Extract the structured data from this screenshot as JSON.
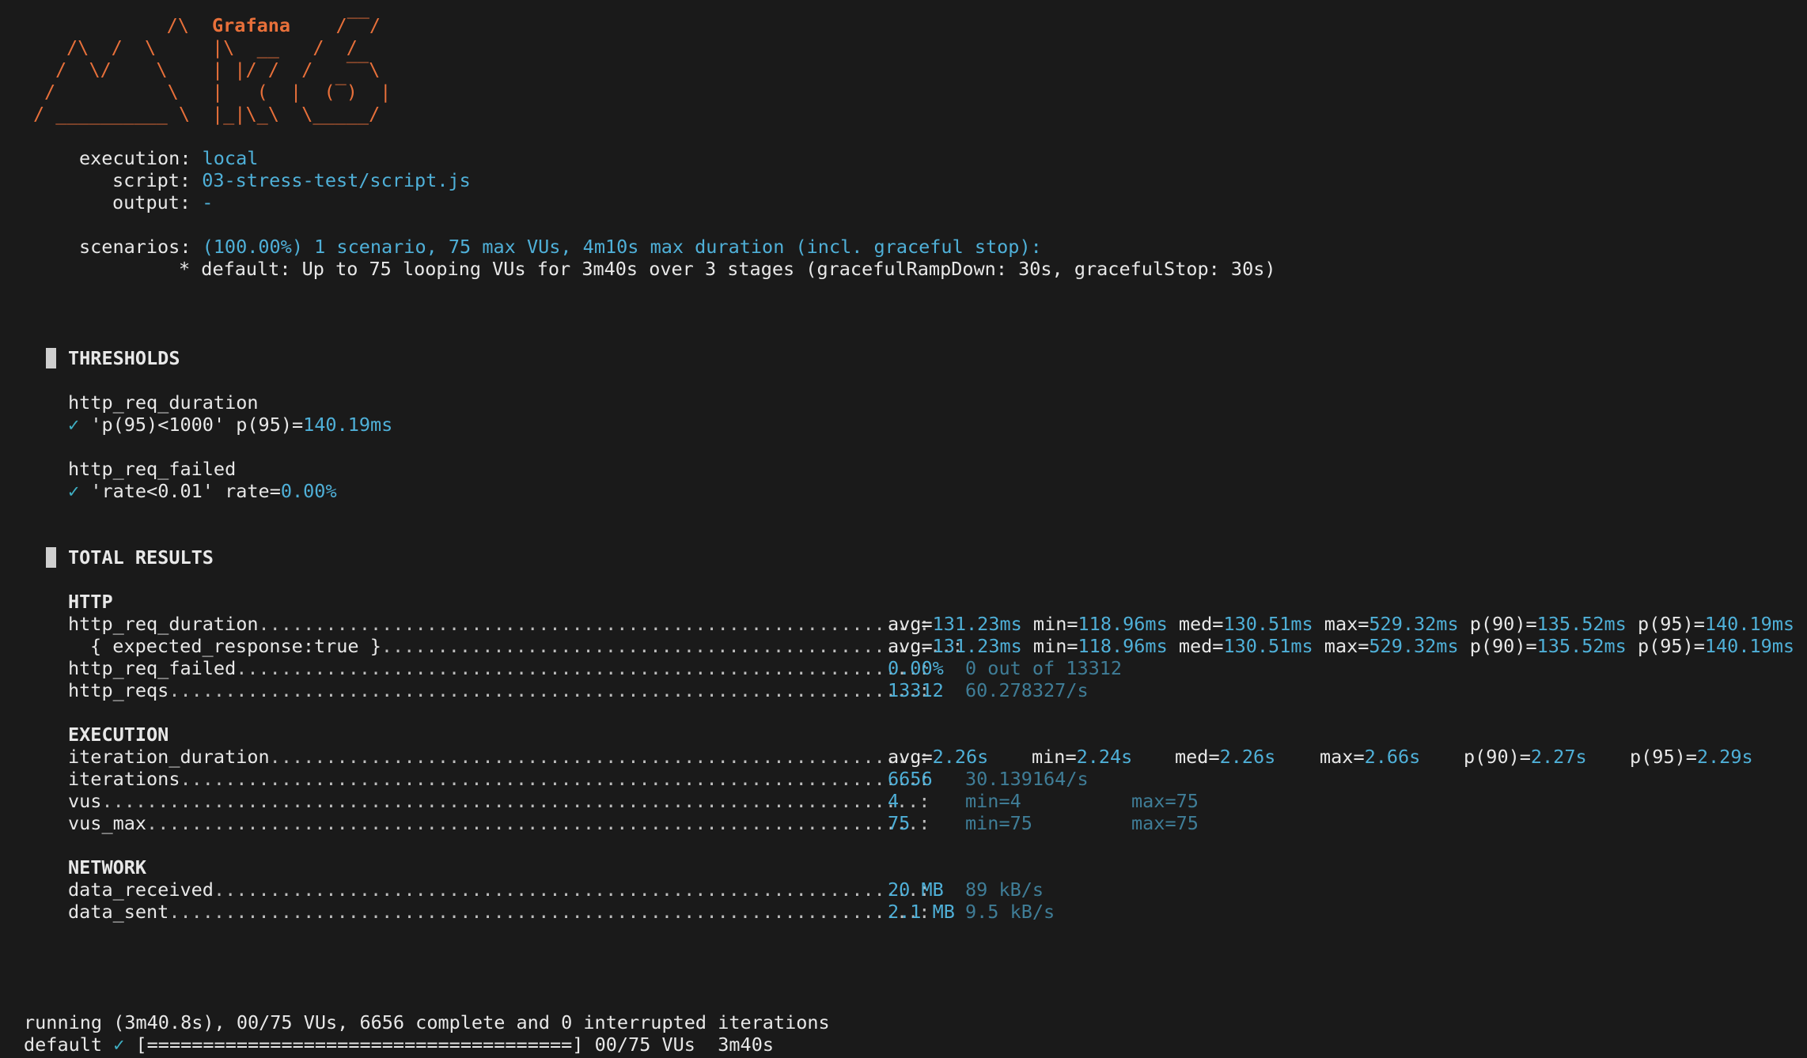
{
  "logo": {
    "brand": "Grafana",
    "art_lines": [
      "    /\\      ",
      "/\\  /  \\     ",
      "/  \\/    \\    ",
      "/          \\   ",
      "/ __________ \\  "
    ],
    "k6_lines": [
      "   /‾‾/",
      "|\\  __   /  /",
      "| |/ /  /   ‾‾\\",
      "|   (  |  (‾)  |",
      "|_|\\_\\  \\_____/"
    ]
  },
  "run_info": {
    "execution_label": "execution:",
    "execution_value": "local",
    "script_label": "script:",
    "script_value": "03-stress-test/script.js",
    "output_label": "output:",
    "output_value": "-",
    "scenarios_label": "scenarios:",
    "scenarios_value": "(100.00%) 1 scenario, 75 max VUs, 4m10s max duration (incl. graceful stop):",
    "scenario_detail": "* default: Up to 75 looping VUs for 3m40s over 3 stages (gracefulRampDown: 30s, gracefulStop: 30s)"
  },
  "thresholds": {
    "title": "THRESHOLDS",
    "items": [
      {
        "metric": "http_req_duration",
        "check": "✓",
        "rule": "'p(95)<1000'",
        "label": "p(95)=",
        "value": "140.19ms"
      },
      {
        "metric": "http_req_failed",
        "check": "✓",
        "rule": "'rate<0.01'",
        "label": "rate=",
        "value": "0.00%"
      }
    ]
  },
  "results": {
    "title": "TOTAL RESULTS",
    "http": {
      "title": "HTTP",
      "req_duration": {
        "name": "http_req_duration",
        "dots": "...........................................................:",
        "avg": "131.23ms",
        "min": "118.96ms",
        "med": "130.51ms",
        "max": "529.32ms",
        "p90": "135.52ms",
        "p95": "140.19ms"
      },
      "expected": {
        "name": "{ expected_response:true }",
        "dots": "...................................................:",
        "avg": "131.23ms",
        "min": "118.96ms",
        "med": "130.51ms",
        "max": "529.32ms",
        "p90": "135.52ms",
        "p95": "140.19ms"
      },
      "req_failed": {
        "name": "http_req_failed",
        "dots": ".............................................................:",
        "value": "0.00%",
        "detail": "0 out of 13312"
      },
      "reqs": {
        "name": "http_reqs",
        "dots": "...................................................................:",
        "value": "13312",
        "rate": "60.278327/s"
      }
    },
    "execution": {
      "title": "EXECUTION",
      "iteration_duration": {
        "name": "iteration_duration",
        "dots": "..........................................................:",
        "avg": "2.26s",
        "min": "2.24s",
        "med": "2.26s",
        "max": "2.66s",
        "p90": "2.27s",
        "p95": "2.29s"
      },
      "iterations": {
        "name": "iterations",
        "dots": "..................................................................:",
        "value": "6656",
        "rate": "30.139164/s"
      },
      "vus": {
        "name": "vus",
        "dots": ".........................................................................:",
        "value": "4",
        "min": "min=4",
        "max": "max=75"
      },
      "vus_max": {
        "name": "vus_max",
        "dots": ".....................................................................:",
        "value": "75",
        "min": "min=75",
        "max": "max=75"
      }
    },
    "network": {
      "title": "NETWORK",
      "data_received": {
        "name": "data_received",
        "dots": "...............................................................:",
        "value": "20 MB",
        "rate": "89 kB/s"
      },
      "data_sent": {
        "name": "data_sent",
        "dots": "...................................................................:",
        "value": "2.1 MB",
        "rate": "9.5 kB/s"
      }
    }
  },
  "footer": {
    "running": "running (3m40.8s), 00/75 VUs, 6656 complete and 0 interrupted iterations",
    "default_label": "default",
    "check": "✓",
    "progress": "[======================================]",
    "vus": "00/75 VUs",
    "duration": "3m40s"
  },
  "colors": {
    "background": "#1a1a1a",
    "text": "#e8e8e8",
    "accent_orange": "#e8703a",
    "value_blue": "#4fb0d8",
    "dim_blue": "#3f7d97"
  }
}
